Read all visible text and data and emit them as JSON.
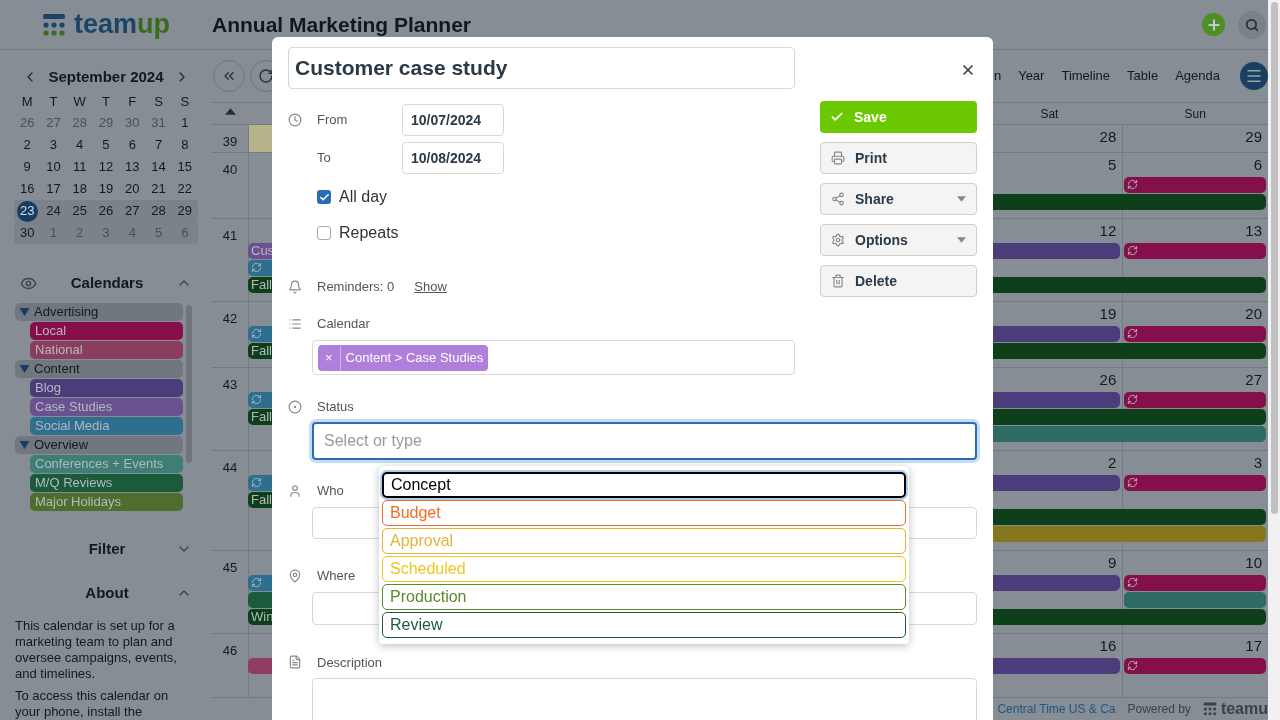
{
  "header": {
    "logo_text": [
      "team",
      "up"
    ],
    "title": "Annual Marketing Planner"
  },
  "mini_calendar": {
    "month": "September 2024",
    "weekdays": [
      "M",
      "T",
      "W",
      "T",
      "F",
      "S",
      "S"
    ],
    "weeks": [
      {
        "days": [
          {
            "label": "26",
            "muted": true,
            "selected": false
          },
          {
            "label": "27",
            "muted": true,
            "selected": false
          },
          {
            "label": "28",
            "muted": true,
            "selected": false
          },
          {
            "label": "29",
            "muted": true,
            "selected": false
          },
          {
            "label": "30",
            "muted": true,
            "selected": false
          },
          {
            "label": "31",
            "muted": true,
            "selected": false
          },
          {
            "label": "1",
            "muted": false,
            "selected": false
          }
        ]
      },
      {
        "days": [
          {
            "label": "2",
            "muted": false,
            "selected": false
          },
          {
            "label": "3",
            "muted": false,
            "selected": false
          },
          {
            "label": "4",
            "muted": false,
            "selected": false
          },
          {
            "label": "5",
            "muted": false,
            "selected": false
          },
          {
            "label": "6",
            "muted": false,
            "selected": false
          },
          {
            "label": "7",
            "muted": false,
            "selected": false
          },
          {
            "label": "8",
            "muted": false,
            "selected": false
          }
        ]
      },
      {
        "days": [
          {
            "label": "9",
            "muted": false,
            "selected": false
          },
          {
            "label": "10",
            "muted": false,
            "selected": false
          },
          {
            "label": "11",
            "muted": false,
            "selected": false
          },
          {
            "label": "12",
            "muted": false,
            "selected": false
          },
          {
            "label": "13",
            "muted": false,
            "selected": false
          },
          {
            "label": "14",
            "muted": false,
            "selected": false
          },
          {
            "label": "15",
            "muted": false,
            "selected": false
          }
        ]
      },
      {
        "days": [
          {
            "label": "16",
            "muted": false,
            "selected": false
          },
          {
            "label": "17",
            "muted": false,
            "selected": false
          },
          {
            "label": "18",
            "muted": false,
            "selected": false
          },
          {
            "label": "19",
            "muted": false,
            "selected": false
          },
          {
            "label": "20",
            "muted": false,
            "selected": false
          },
          {
            "label": "21",
            "muted": false,
            "selected": false
          },
          {
            "label": "22",
            "muted": false,
            "selected": false
          }
        ]
      },
      {
        "highlighted": true,
        "days": [
          {
            "label": "23",
            "muted": false,
            "selected": true
          },
          {
            "label": "24",
            "muted": false,
            "selected": false
          },
          {
            "label": "25",
            "muted": false,
            "selected": false
          },
          {
            "label": "26",
            "muted": false,
            "selected": false
          },
          {
            "label": "27",
            "muted": false,
            "selected": false
          },
          {
            "label": "28",
            "muted": false,
            "selected": false
          },
          {
            "label": "29",
            "muted": false,
            "selected": false
          }
        ]
      },
      {
        "highlighted": true,
        "days": [
          {
            "label": "30",
            "muted": false,
            "selected": false
          },
          {
            "label": "1",
            "muted": true,
            "selected": false
          },
          {
            "label": "2",
            "muted": true,
            "selected": false
          },
          {
            "label": "3",
            "muted": true,
            "selected": false
          },
          {
            "label": "4",
            "muted": true,
            "selected": false
          },
          {
            "label": "5",
            "muted": true,
            "selected": false
          },
          {
            "label": "6",
            "muted": true,
            "selected": false
          }
        ]
      }
    ]
  },
  "calendars": {
    "title": "Calendars",
    "expanded": true,
    "groups": [
      {
        "label": "Advertising",
        "expanded": true,
        "children": [
          {
            "label": "Local",
            "color": "#850f4a"
          },
          {
            "label": "National",
            "color": "#8a3d5c"
          }
        ]
      },
      {
        "label": "Content",
        "expanded": true,
        "children": [
          {
            "label": "Blog",
            "color": "#4b3c7c"
          },
          {
            "label": "Case Studies",
            "color": "#6a5291"
          },
          {
            "label": "Social Media",
            "color": "#2e6e8f"
          }
        ]
      },
      {
        "label": "Overview",
        "expanded": true,
        "children": [
          {
            "label": "Conferences + Events",
            "color": "#3d7f73"
          },
          {
            "label": "M/Q Reviews",
            "color": "#1b5a3a"
          },
          {
            "label": "Major Holidays",
            "color": "#4f6e2d"
          }
        ]
      }
    ]
  },
  "filter": {
    "title": "Filter",
    "expanded": false
  },
  "about": {
    "title": "About",
    "expanded": true,
    "paragraphs": [
      "This calendar is set up for a marketing team to plan and oversee campaigns, events, and timelines.",
      "To access this calendar on your phone, install the"
    ]
  },
  "toolbar": {
    "views": [
      {
        "label": "n",
        "selected": false
      },
      {
        "label": "Year",
        "selected": false
      },
      {
        "label": "Timeline",
        "selected": false
      },
      {
        "label": "Table",
        "selected": false
      },
      {
        "label": "Agenda",
        "selected": false
      }
    ]
  },
  "calendar": {
    "day_headers": {
      "sat": "Sat",
      "sun": "Sun"
    },
    "weeks": [
      {
        "number": "39",
        "today_mon": true,
        "sat": "28",
        "sun": "29"
      },
      {
        "number": "40",
        "sat": "5",
        "sun": "6",
        "lanes": [
          [
            {
              "kind": "sun",
              "color": "#850f4a",
              "recurring": true
            }
          ],
          [
            {
              "kind": "end",
              "color": "#0e3f1b"
            }
          ]
        ]
      },
      {
        "number": "41",
        "sat": "12",
        "sun": "13",
        "lanes": [
          [
            {
              "kind": "start",
              "color": "#6a5291",
              "label": "Cus",
              "recurring": false
            },
            {
              "kind": "sat",
              "color": "#4b3c7c"
            },
            {
              "kind": "sun",
              "color": "#850f4a",
              "recurring": true
            }
          ],
          [
            {
              "kind": "mon",
              "color": "#2e6e8f",
              "recurring": true
            }
          ],
          [
            {
              "kind": "week",
              "color": "#0e3f1b",
              "label": "Fall",
              "recurring": false
            }
          ]
        ]
      },
      {
        "number": "42",
        "sat": "19",
        "sun": "20",
        "lanes": [
          [
            {
              "kind": "mon",
              "color": "#2e6e8f",
              "recurring": true
            },
            {
              "kind": "sat",
              "color": "#4b3c7c"
            },
            {
              "kind": "sun",
              "color": "#850f4a",
              "recurring": true
            }
          ],
          [
            {
              "kind": "week",
              "color": "#0e3f1b",
              "label": "Fall",
              "recurring": false
            }
          ]
        ]
      },
      {
        "number": "43",
        "sat": "26",
        "sun": "27",
        "lanes": [
          [
            {
              "kind": "mon",
              "color": "#2e6e8f",
              "recurring": true
            },
            {
              "kind": "sat",
              "color": "#4b3c7c"
            },
            {
              "kind": "sun",
              "color": "#850f4a",
              "recurring": true
            }
          ],
          [
            {
              "kind": "week",
              "color": "#0e3f1b",
              "label": "Fall",
              "recurring": false
            }
          ],
          [
            {
              "kind": "end",
              "color": "#2e6b63"
            }
          ]
        ]
      },
      {
        "number": "44",
        "sat": "2",
        "sun": "3",
        "lanes": [
          [
            {
              "kind": "mon",
              "color": "#2e6e8f",
              "recurring": true
            },
            {
              "kind": "sat",
              "color": "#4b3c7c"
            },
            {
              "kind": "sun",
              "color": "#850f4a",
              "recurring": true
            }
          ],
          [
            {
              "kind": "start",
              "color": "#0e3f1b",
              "label": "Fall",
              "recurring": false
            }
          ],
          [
            {
              "kind": "end",
              "color": "#0e3f1b"
            }
          ],
          [
            {
              "kind": "end",
              "color": "#86761f"
            }
          ]
        ]
      },
      {
        "number": "45",
        "sat": "9",
        "sun": "10",
        "lanes": [
          [
            {
              "kind": "mon",
              "color": "#2e6e8f",
              "recurring": true
            },
            {
              "kind": "sat",
              "color": "#4b3c7c"
            },
            {
              "kind": "sun",
              "color": "#850f4a",
              "recurring": true
            }
          ],
          [
            {
              "kind": "start",
              "color": "#1b5a3a",
              "recurring": false
            },
            {
              "kind": "sun",
              "color": "#2e6b63",
              "recurring": false
            }
          ],
          [
            {
              "kind": "week",
              "color": "#0e3f1b",
              "label": "Win",
              "recurring": false
            }
          ]
        ]
      },
      {
        "number": "46",
        "sat": "16",
        "sun": "17",
        "lanes": [
          [
            {
              "kind": "start",
              "color": "#8f3d62",
              "recurring": false
            },
            {
              "kind": "sat",
              "color": "#4b3c7c"
            },
            {
              "kind": "sun",
              "color": "#850f4a",
              "recurring": true
            }
          ]
        ]
      }
    ]
  },
  "footer": {
    "timezone": "Central Time US & Ca",
    "powered_by": "Powered by",
    "brand": "teamu"
  },
  "dialog": {
    "title": "Customer case study",
    "from": {
      "label": "From",
      "value": "10/07/2024"
    },
    "to": {
      "label": "To",
      "value": "10/08/2024"
    },
    "options": [
      {
        "label": "All day",
        "checked": true
      },
      {
        "label": "Repeats",
        "checked": false
      }
    ],
    "reminders": {
      "label": "Reminders: 0",
      "link": "Show"
    },
    "calendar": {
      "label": "Calendar",
      "chips": [
        {
          "label": "Content > Case Studies",
          "remove": "×",
          "color": "#b07fdc"
        }
      ]
    },
    "status": {
      "label": "Status",
      "placeholder": "Select or type",
      "open": true,
      "options": [
        {
          "label": "Concept",
          "color": "#000000",
          "selected": true
        },
        {
          "label": "Budget",
          "color": "#f26b2a",
          "selected": false
        },
        {
          "label": "Approval",
          "color": "#e3b43a",
          "selected": false
        },
        {
          "label": "Scheduled",
          "color": "#f2c41c",
          "selected": false
        },
        {
          "label": "Production",
          "color": "#5b8a2b",
          "selected": false
        },
        {
          "label": "Review",
          "color": "#1f5a3f",
          "selected": false
        }
      ]
    },
    "who": {
      "label": "Who"
    },
    "where": {
      "label": "Where"
    },
    "description": {
      "label": "Description"
    },
    "actions": [
      {
        "label": "Save",
        "kind": "primary"
      },
      {
        "label": "Print",
        "kind": "plain"
      },
      {
        "label": "Share",
        "kind": "menu"
      },
      {
        "label": "Options",
        "kind": "menu"
      },
      {
        "label": "Delete",
        "kind": "plain"
      }
    ]
  }
}
